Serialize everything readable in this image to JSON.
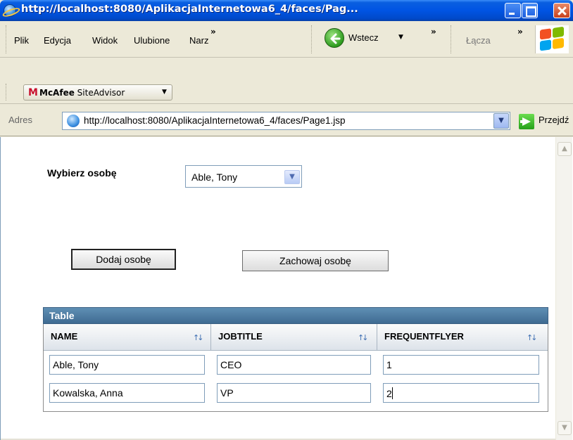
{
  "window": {
    "title": "http://localhost:8080/AplikacjaInternetowa6_4/faces/Pag..."
  },
  "menu": {
    "items": [
      "Plik",
      "Edycja",
      "Widok",
      "Ulubione",
      "Narz"
    ],
    "chevron": "»",
    "back_label": "Wstecz",
    "links_label": "Łącza"
  },
  "toolbar": {
    "mcafee_logo": "M",
    "mcafee_brand": "McAfee",
    "mcafee_suffix": " SiteAdvisor"
  },
  "address": {
    "label": "Adres",
    "url": "http://localhost:8080/AplikacjaInternetowa6_4/faces/Page1.jsp",
    "go_label": "Przejdź"
  },
  "page": {
    "select_label": "Wybierz osobę",
    "selected_person": "Able, Tony",
    "add_button": "Dodaj osobę",
    "keep_button": "Zachowaj osobę",
    "table": {
      "title": "Table",
      "columns": [
        "NAME",
        "JOBTITLE",
        "FREQUENTFLYER"
      ],
      "rows": [
        [
          "Able, Tony",
          "CEO",
          "1"
        ],
        [
          "Kowalska, Anna",
          "VP",
          "2"
        ]
      ]
    }
  },
  "icons": {
    "sort": "sort-icon",
    "dropdown": "chevron-down-icon",
    "back": "back-arrow-icon",
    "go": "go-arrow-icon",
    "ie": "ie-logo-icon",
    "windows": "windows-logo-icon"
  },
  "colors": {
    "titlebar": "#0054e3",
    "table_header": "#4f7ca3",
    "mcafee_red": "#c8102e"
  }
}
